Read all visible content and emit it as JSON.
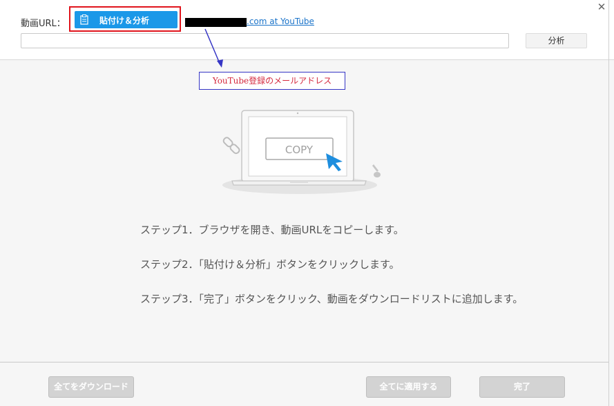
{
  "header": {
    "url_label": "動画URL：",
    "paste_button_label": "貼付け＆分析",
    "redacted_link_text": ".com at YouTube",
    "url_input_value": "",
    "url_input_placeholder": "",
    "analyze_button_label": "分析",
    "close_label": "✕"
  },
  "annotation": {
    "text": "YouTube登録のメールアドレス",
    "text_color": "#d4283d",
    "border_color": "#3535c5"
  },
  "illustration": {
    "copy_label": "COPY"
  },
  "steps": [
    "ステップ1．ブラウザを開き、動画URLをコピーします。",
    "ステップ2．「貼付け＆分析」ボタンをクリックします。",
    "ステップ3．「完了」ボタンをクリック、動画をダウンロードリストに追加します。"
  ],
  "footer": {
    "download_all_label": "全てをダウンロード",
    "apply_all_label": "全てに適用する",
    "done_label": "完了"
  },
  "colors": {
    "accent": "#1b98e8",
    "highlight_border": "#e0141c",
    "disabled_button": "#d3d3d3"
  }
}
